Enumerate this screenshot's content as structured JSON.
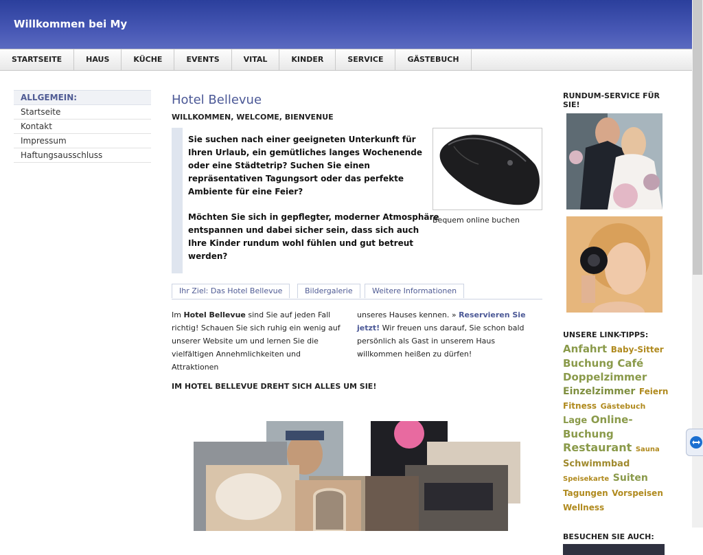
{
  "header": {
    "title": "Willkommen bei My"
  },
  "nav": {
    "items": [
      "STARTSEITE",
      "HAUS",
      "KÜCHE",
      "EVENTS",
      "VITAL",
      "KINDER",
      "SERVICE",
      "GÄSTEBUCH"
    ]
  },
  "left_menu": {
    "heading": "ALLGEMEIN:",
    "items": [
      "Startseite",
      "Kontakt",
      "Impressum",
      "Haftungsausschluss"
    ]
  },
  "main": {
    "title": "Hotel Bellevue",
    "subtitle": "WILLKOMMEN, WELCOME, BIENVENUE",
    "quote_p1": "Sie suchen nach einer geeigneten Unterkunft für Ihren Urlaub, ein gemütliches langes Wochenende oder eine Städtetrip? Suchen Sie einen repräsentativen Tagungsort oder das perfekte Ambiente für eine Feier?",
    "quote_p2": "Möchten Sie sich in gepflegter, moderner Atmosphäre entspannen und dabei sicher sein, dass sich auch Ihre Kinder rundum wohl fühlen und gut betreut werden?",
    "image_caption": "Bequem online buchen",
    "tabs": [
      "Ihr Ziel: Das Hotel Bellevue",
      "Bildergalerie",
      "Weitere Informationen"
    ],
    "col1_pre": "Im ",
    "col1_bold": "Hotel Bellevue",
    "col1_post": " sind Sie auf jeden Fall richtig! Schauen Sie sich ruhig ein wenig auf unserer Website um und lernen Sie die vielfältigen Annehmlichkeiten und Attraktionen",
    "col2_pre": "unseres Hauses kennen. » ",
    "col2_link": "Reservieren Sie jetzt!",
    "col2_post": " Wir freuen uns darauf, Sie schon bald persönlich als Gast in unserem Haus willkommen heißen zu dürfen!",
    "tagline": "IM HOTEL BELLEVUE DREHT SICH ALLES UM SIE!"
  },
  "right": {
    "service_title": "RUNDUM-SERVICE FÜR SIE!",
    "links_title": "UNSERE LINK-TIPPS:",
    "tags": [
      "Anfahrt",
      "Baby-Sitter",
      "Buchung",
      "Café",
      "Doppelzimmer",
      "Einzelzimmer",
      "Feiern",
      "Fitness",
      "Gästebuch",
      "Lage",
      "Online-Buchung",
      "Restaurant",
      "Sauna",
      "Schwimmbad",
      "Speisekarte",
      "Suiten",
      "Tagungen",
      "Vorspeisen",
      "Wellness"
    ],
    "visit_title": "BESUCHEN SIE AUCH:"
  },
  "colors": {
    "header_blue": "#3a4ca8",
    "title_blue": "#4b5896",
    "tag_green": "#8a9a4a",
    "tag_gold": "#b08a1e"
  }
}
